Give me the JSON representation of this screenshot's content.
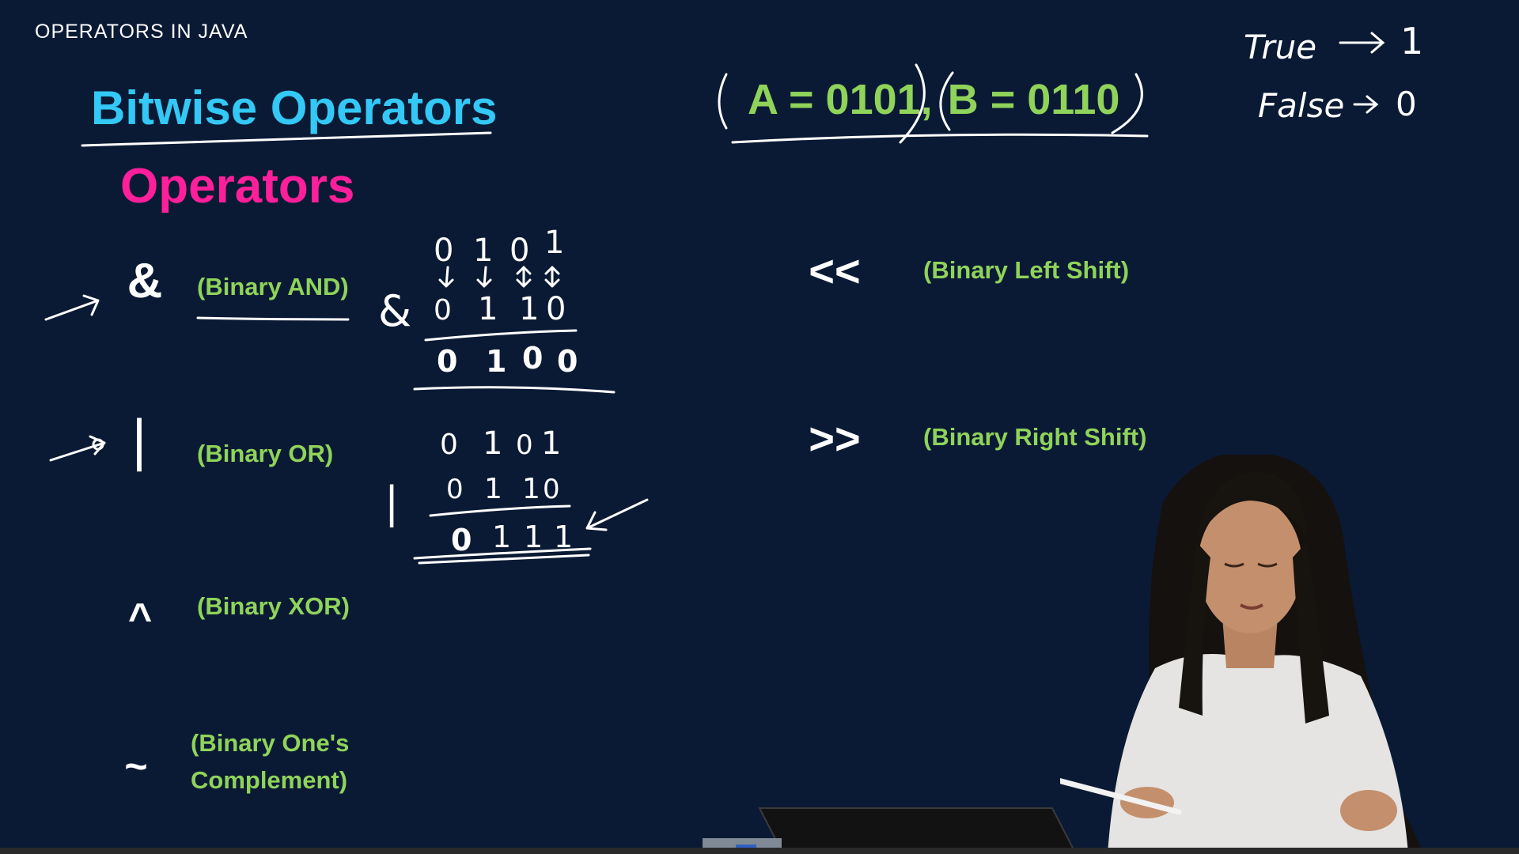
{
  "header": {
    "label": "OPERATORS IN JAVA"
  },
  "title": "Bitwise Operators",
  "subtitle": "Operators",
  "operators": [
    {
      "symbol": "&",
      "description": "(Binary AND)"
    },
    {
      "symbol": "|",
      "description": "(Binary OR)"
    },
    {
      "symbol": "^",
      "description": "(Binary XOR)"
    },
    {
      "symbol": "~",
      "description": "(Binary One's Complement)"
    },
    {
      "symbol": "<<",
      "description": "(Binary Left Shift)"
    },
    {
      "symbol": ">>",
      "description": "(Binary Right Shift)"
    }
  ],
  "definitions": {
    "a": "A = 0101",
    "sep": ",",
    "b": "B = 0110"
  },
  "truth_notes": [
    {
      "text": "True",
      "value": "1"
    },
    {
      "text": "False",
      "value": "0"
    }
  ],
  "and_example": {
    "operator": "&",
    "row_a": [
      "0",
      "1",
      "0",
      "1"
    ],
    "row_b": [
      "0",
      "1",
      "1",
      "0"
    ],
    "result": [
      "0",
      "1",
      "0",
      "0"
    ]
  },
  "or_example": {
    "operator": "|",
    "row_a": [
      "0",
      "1",
      "0",
      "1"
    ],
    "row_b": [
      "0",
      "1",
      "1",
      "0"
    ],
    "result": [
      "0",
      "1",
      "1",
      "1"
    ]
  },
  "colors": {
    "background": "#0b1a34",
    "title": "#33c8f5",
    "subtitle": "#ff1f9a",
    "description": "#8fd35a",
    "ink": "#ffffff"
  }
}
